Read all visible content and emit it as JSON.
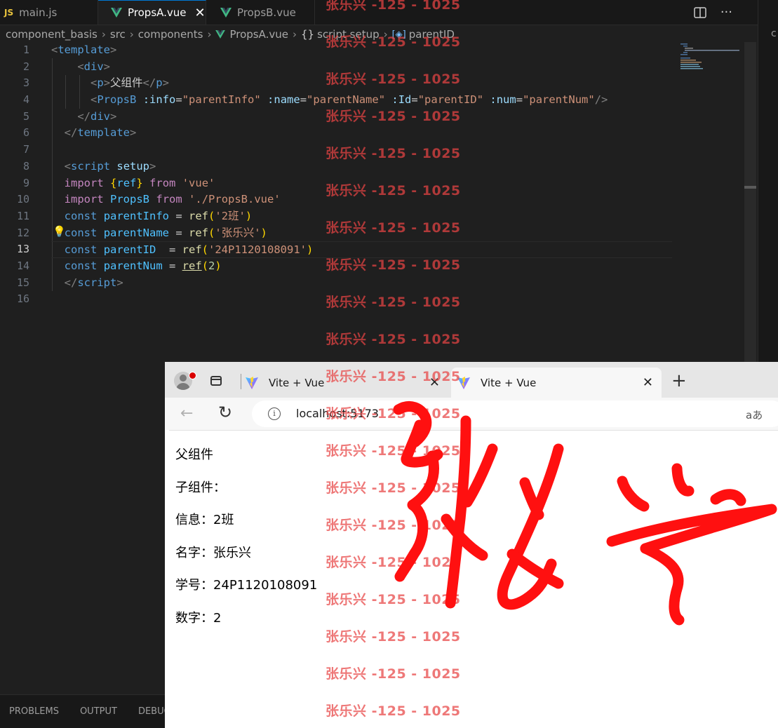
{
  "vscode": {
    "tabs": [
      {
        "label": "main.js",
        "badge": "JS",
        "kind": "js"
      },
      {
        "label": "PropsA.vue",
        "kind": "vue",
        "active": true
      },
      {
        "label": "PropsB.vue",
        "kind": "vue"
      }
    ],
    "breadcrumb": {
      "parts": [
        "component_basis",
        "src",
        "components",
        "PropsA.vue"
      ],
      "braces": "{}",
      "section": "script setup",
      "symbol": "parentID"
    },
    "right_strip_text": "c",
    "current_line": 13,
    "lines": [
      {
        "n": "1"
      },
      {
        "n": "2"
      },
      {
        "n": "3"
      },
      {
        "n": "4"
      },
      {
        "n": "5"
      },
      {
        "n": "6"
      },
      {
        "n": "7"
      },
      {
        "n": "8"
      },
      {
        "n": "9"
      },
      {
        "n": "10"
      },
      {
        "n": "11"
      },
      {
        "n": "12"
      },
      {
        "n": "13"
      },
      {
        "n": "14"
      },
      {
        "n": "15"
      },
      {
        "n": "16"
      }
    ],
    "code": {
      "l1": {
        "open": "<",
        "tag": "template",
        "close": ">"
      },
      "l2": {
        "open": "<",
        "tag": "div",
        "close": ">"
      },
      "l3": {
        "open": "<",
        "tag": "p",
        "close": ">",
        "text": "父组件",
        "end_open": "</",
        "end_tag": "p",
        "end_close": ">"
      },
      "l4": {
        "open": "<",
        "tag": "PropsB",
        "a1": ":info",
        "v1": "\"parentInfo\"",
        "a2": ":name",
        "v2": "\"parentName\"",
        "a3": ":Id",
        "v3": "\"parentID\"",
        "a4": ":num",
        "v4": "\"parentNum\"",
        "eq": "=",
        "close": "/>"
      },
      "l5": {
        "open": "</",
        "tag": "div",
        "close": ">"
      },
      "l6": {
        "open": "</",
        "tag": "template",
        "close": ">"
      },
      "l8": {
        "open": "<",
        "tag": "script",
        "attr": "setup",
        "close": ">"
      },
      "l9": {
        "kw": "import",
        "lb": "{",
        "name": "ref",
        "rb": "}",
        "from": "from",
        "str": "'vue'"
      },
      "l10": {
        "kw": "import",
        "name": "PropsB",
        "from": "from",
        "str": "'./PropsB.vue'"
      },
      "l11": {
        "kw": "const",
        "var": "parentInfo",
        "eq": " = ",
        "fn": "ref",
        "lp": "(",
        "str": "'2班'",
        "rp": ")"
      },
      "l12": {
        "kw": "const",
        "var": "parentName",
        "eq": " = ",
        "fn": "ref",
        "lp": "(",
        "str": "'张乐兴'",
        "rp": ")"
      },
      "l13": {
        "kw": "const",
        "var": "parentID",
        "eq": "  = ",
        "fn": "ref",
        "lp": "(",
        "str": "'24P1120108091'",
        "rp": ")"
      },
      "l14": {
        "kw": "const",
        "var": "parentNum",
        "eq": " = ",
        "fn": "ref",
        "lp": "(",
        "num": "2",
        "rp": ")"
      },
      "l15": {
        "open": "</",
        "tag": "script",
        "close": ">"
      }
    },
    "panel_tabs": [
      "PROBLEMS",
      "OUTPUT",
      "DEBUG CONSOLE"
    ]
  },
  "browser": {
    "tabs": [
      {
        "title": "Vite + Vue",
        "active": false
      },
      {
        "title": "Vite + Vue",
        "active": true
      }
    ],
    "new_tab": "+",
    "url": "localhost:5173",
    "translate_glyph": "aあ",
    "page_lines": [
      "父组件",
      "子组件：",
      "信息：2班",
      "名字：张乐兴",
      "学号：24P1120108091",
      "数字：2"
    ]
  },
  "watermark": {
    "text": "张乐兴 -125 - 1025",
    "count": 20,
    "color": "#e84444"
  },
  "ink": {
    "color": "#ff1010"
  }
}
